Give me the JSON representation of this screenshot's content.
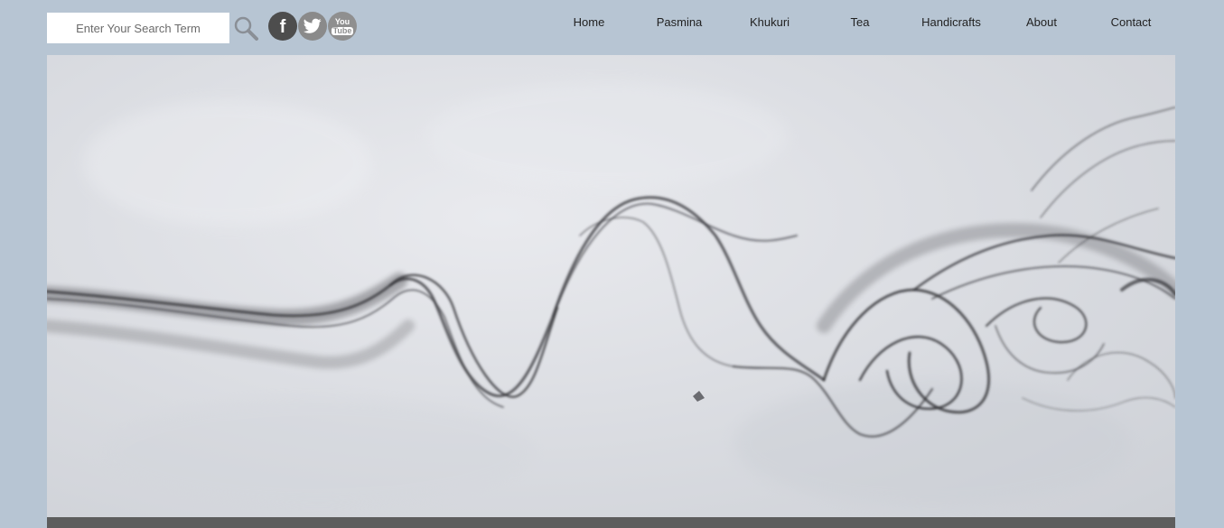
{
  "search": {
    "placeholder": "Enter Your Search Term"
  },
  "social": [
    {
      "name": "facebook",
      "glyph": "f"
    },
    {
      "name": "twitter",
      "glyph": "twitter-bird"
    },
    {
      "name": "youtube",
      "glyph_top": "You",
      "glyph_bottom": "Tube"
    }
  ],
  "nav": {
    "items": [
      {
        "label": "Home"
      },
      {
        "label": "Pasmina"
      },
      {
        "label": "Khukuri"
      },
      {
        "label": "Tea"
      },
      {
        "label": "Handicrafts"
      },
      {
        "label": "About"
      },
      {
        "label": "Contact"
      }
    ]
  },
  "hero": {
    "image": "smoke-wisp-on-grey-texture"
  },
  "colors": {
    "page_background": "#b7c5d3",
    "bottom_bar": "#5d5d5d",
    "nav_text": "#222222"
  }
}
